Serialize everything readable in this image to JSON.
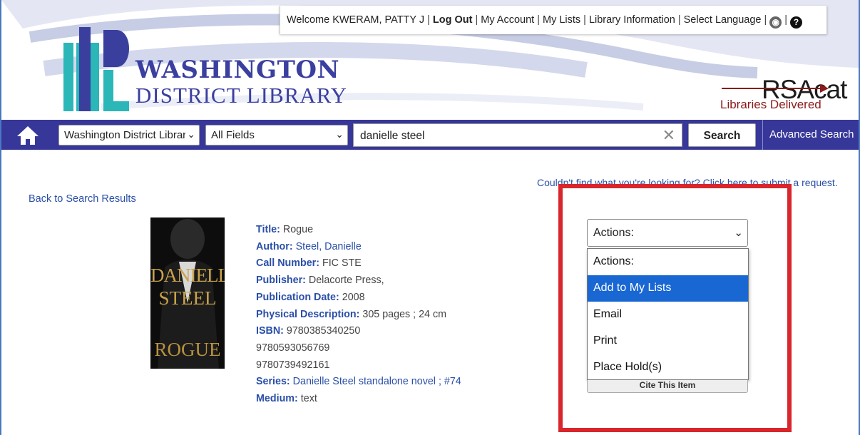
{
  "userbar": {
    "welcome": "Welcome KWERAM, PATTY J",
    "logout": "Log Out",
    "my_account": "My Account",
    "my_lists": "My Lists",
    "library_info": "Library Information",
    "select_language": "Select Language",
    "globe_icon": "globe-icon",
    "help_icon": "help-icon"
  },
  "logo": {
    "title_line1": "WASHINGTON",
    "title_line2": "DISTRICT LIBRARY",
    "partner_name": "RSAcat",
    "partner_tagline": "Libraries Delivered"
  },
  "search": {
    "library_select": "Washington District Library",
    "field_select": "All Fields",
    "query": "danielle steel",
    "button": "Search",
    "advanced": "Advanced Search"
  },
  "links": {
    "couldnt_find": "Couldn't find what you're looking for? Click here to submit a request.",
    "back": "Back to Search Results"
  },
  "cover": {
    "line1": "DANIELLE",
    "line2": "STEEL",
    "line3": "ROGUE"
  },
  "record": {
    "title_label": "Title:",
    "title": "Rogue",
    "author_label": "Author:",
    "author": "Steel, Danielle",
    "call_label": "Call Number:",
    "call": "FIC STE",
    "publisher_label": "Publisher:",
    "publisher": "Delacorte Press,",
    "pubdate_label": "Publication Date:",
    "pubdate": "2008",
    "physical_label": "Physical Description:",
    "physical": "305 pages ; 24 cm",
    "isbn_label": "ISBN:",
    "isbn": [
      "9780385340250",
      "9780593056769",
      "9780739492161"
    ],
    "series_label": "Series:",
    "series": "Danielle Steel standalone novel ; #74",
    "medium_label": "Medium:",
    "medium": "text"
  },
  "actions": {
    "selected": "Actions:",
    "options": [
      "Actions:",
      "Add to My Lists",
      "Email",
      "Print",
      "Place Hold(s)"
    ],
    "highlighted": "Add to My Lists",
    "cite": "Cite This Item"
  },
  "colors": {
    "nav_bar": "#37379a",
    "link": "#2a4fa8",
    "highlight": "#1967d2",
    "annotation": "#d9262c"
  }
}
